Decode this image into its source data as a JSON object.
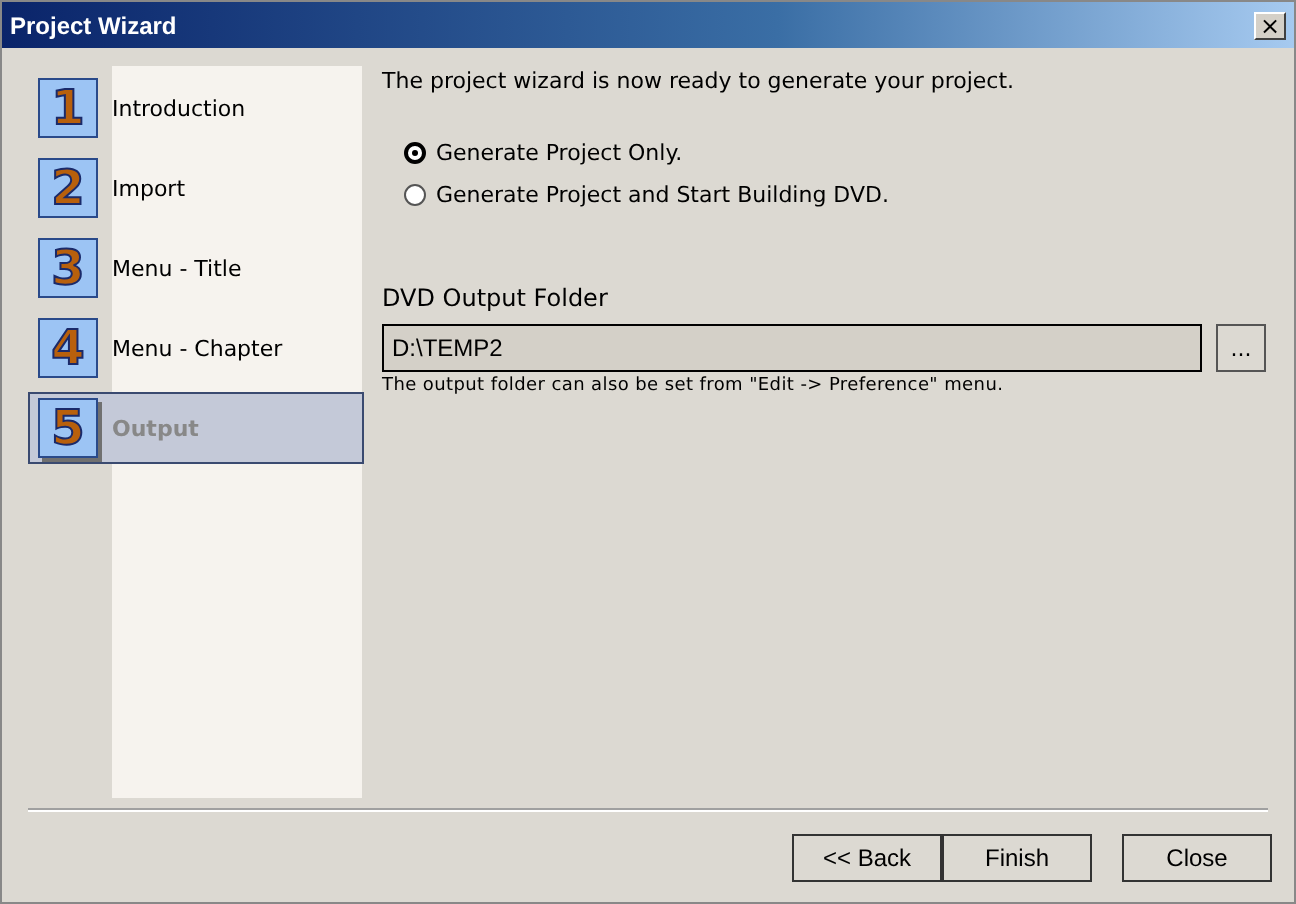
{
  "window": {
    "title": "Project Wizard",
    "close": "×"
  },
  "steps": [
    {
      "number": "1",
      "label": "Introduction",
      "selected": false
    },
    {
      "number": "2",
      "label": "Import",
      "selected": false
    },
    {
      "number": "3",
      "label": "Menu - Title",
      "selected": false
    },
    {
      "number": "4",
      "label": "Menu - Chapter",
      "selected": false
    },
    {
      "number": "5",
      "label": "Output",
      "selected": true
    }
  ],
  "heading": "The project wizard is now ready to generate your project.",
  "options": [
    {
      "label": "Generate Project Only.",
      "selected": true
    },
    {
      "label": "Generate Project and Start Building DVD.",
      "selected": false
    }
  ],
  "output_folder": {
    "label": "DVD Output Folder",
    "value": "D:\\TEMP2",
    "browse": "...",
    "hint": "The output folder can also be set from \"Edit -> Preference\" menu."
  },
  "buttons": [
    "<< Back",
    "Finish",
    "Close"
  ]
}
